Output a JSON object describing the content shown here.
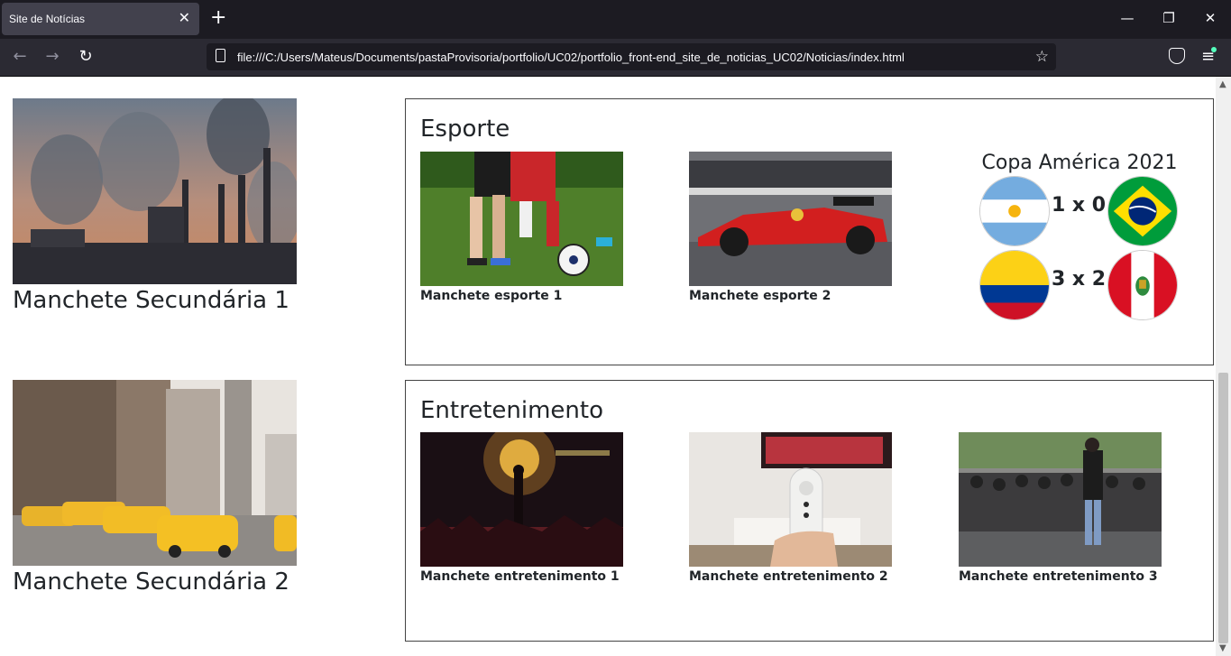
{
  "browser": {
    "tab_title": "Site de Notícias",
    "tab_close": "✕",
    "new_tab": "+",
    "url": "file:///C:/Users/Mateus/Documents/pastaProvisoria/portfolio/UC02/portfolio_front-end_site_de_noticias_UC02/Noticias/index.html",
    "window_controls": {
      "minimize": "—",
      "maximize": "❐",
      "close": "✕"
    },
    "nav": {
      "back": "←",
      "forward": "→",
      "reload": "↻",
      "bookmark": "☆",
      "menu": "≡"
    },
    "icons": [
      "page-icon",
      "star-icon",
      "pocket-icon",
      "menu-icon"
    ]
  },
  "secondary_news": [
    {
      "headline": "Manchete Secundária 1",
      "image": "factory-smokestacks-photo"
    },
    {
      "headline": "Manchete Secundária 2",
      "image": "new-york-taxis-photo"
    }
  ],
  "sections": {
    "sports": {
      "title": "Esporte",
      "cards": [
        {
          "caption": "Manchete esporte 1",
          "image": "soccer-players-photo"
        },
        {
          "caption": "Manchete esporte 2",
          "image": "formula1-car-photo"
        }
      ],
      "copa": {
        "title": "Copa América 2021",
        "matches": [
          {
            "home": "argentina-flag",
            "score": "1 x 0",
            "away": "brazil-flag"
          },
          {
            "home": "colombia-flag",
            "score": "3 x 2",
            "away": "peru-flag"
          }
        ]
      }
    },
    "entertainment": {
      "title": "Entretenimento",
      "cards": [
        {
          "caption": "Manchete entretenimento 1",
          "image": "concert-crowd-photo"
        },
        {
          "caption": "Manchete entretenimento 2",
          "image": "tv-remote-photo"
        },
        {
          "caption": "Manchete entretenimento 3",
          "image": "fashion-photographers-photo"
        }
      ]
    }
  },
  "colors": {
    "chrome_dark": "#1c1b22",
    "chrome_tab": "#42414d",
    "toolbar": "#2b2a33",
    "text": "#212529",
    "border": "#444444"
  }
}
